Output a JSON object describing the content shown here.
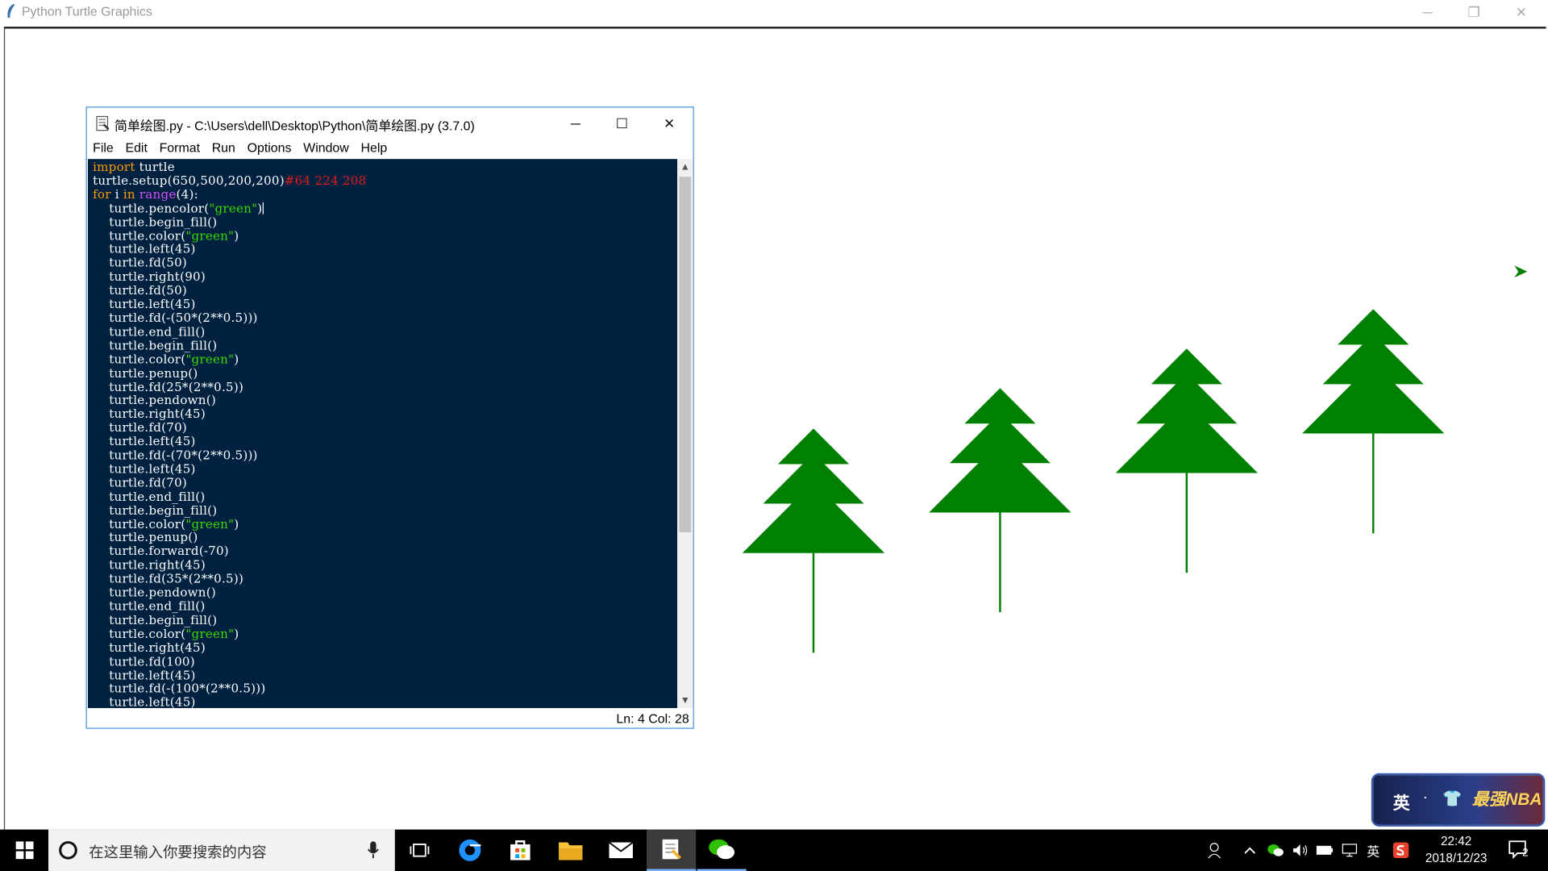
{
  "window": {
    "title": "Python Turtle Graphics",
    "minimize": "─",
    "restore": "❐",
    "close": "✕"
  },
  "idle": {
    "title": "简单绘图.py - C:\\Users\\dell\\Desktop\\Python\\简单绘图.py (3.7.0)",
    "minimize": "─",
    "maximize": "☐",
    "close": "✕",
    "menu": [
      "File",
      "Edit",
      "Format",
      "Run",
      "Options",
      "Window",
      "Help"
    ],
    "status": "Ln: 4   Col: 28"
  },
  "code": {
    "l1_kw": "import",
    "l1_rest": " turtle",
    "l2_code": "turtle.setup(650,500,200,200)",
    "l2_comment": "#64 224 208",
    "l3_for": "for",
    "l3_i": " i ",
    "l3_in": "in",
    "l3_sp": " ",
    "l3_range": "range",
    "l3_rest": "(4):",
    "l4_a": "    turtle.pencolor(",
    "l4_str": "\"green\"",
    "l4_b": ")",
    "lines_a": [
      "    turtle.begin_fill()"
    ],
    "color_a": "    turtle.color(",
    "color_str": "\"green\"",
    "color_b": ")",
    "lines_b": [
      "    turtle.left(45)",
      "    turtle.fd(50)",
      "    turtle.right(90)",
      "    turtle.fd(50)",
      "    turtle.left(45)",
      "    turtle.fd(-(50*(2**0.5)))",
      "    turtle.end_fill()",
      "    turtle.begin_fill()"
    ],
    "lines_c": [
      "    turtle.penup()",
      "    turtle.fd(25*(2**0.5))",
      "    turtle.pendown()",
      "    turtle.right(45)",
      "    turtle.fd(70)",
      "    turtle.left(45)",
      "    turtle.fd(-(70*(2**0.5)))",
      "    turtle.left(45)",
      "    turtle.fd(70)",
      "    turtle.end_fill()",
      "    turtle.begin_fill()"
    ],
    "lines_d": [
      "    turtle.penup()",
      "    turtle.forward(-70)",
      "    turtle.right(45)",
      "    turtle.fd(35*(2**0.5))",
      "    turtle.pendown()",
      "    turtle.end_fill()",
      "    turtle.begin_fill()"
    ],
    "lines_e": [
      "    turtle.right(45)",
      "    turtle.fd(100)",
      "    turtle.left(45)",
      "    turtle.fd(-(100*(2**0.5)))",
      "    turtle.left(45)"
    ]
  },
  "canvas": {
    "tree_color": "#008000",
    "tree_count": 4,
    "turtle_color": "#008000"
  },
  "nba": {
    "ying": "英",
    "brand": "最强NBA"
  },
  "taskbar": {
    "search_placeholder": "在这里输入你要搜索的内容",
    "tray_lang": "英",
    "time": "22:42",
    "date": "2018/12/23",
    "notification_count": "2"
  },
  "colors": {
    "editor_bg": "#002240",
    "keyword": "#ff9d00",
    "builtin": "#d84bff",
    "string": "#3ad900",
    "comment": "#e21a1a"
  }
}
